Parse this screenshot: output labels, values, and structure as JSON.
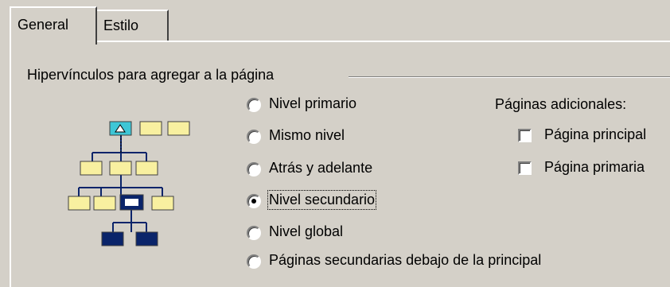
{
  "tabs": [
    {
      "label": "General"
    },
    {
      "label": "Estilo"
    }
  ],
  "group": {
    "label": "Hipervínculos para agregar a la página"
  },
  "options": [
    {
      "label": "Nivel primario",
      "selected": false
    },
    {
      "label": "Mismo nivel",
      "selected": false
    },
    {
      "label": "Atrás y adelante",
      "selected": false
    },
    {
      "label": "Nivel secundario",
      "selected": true
    },
    {
      "label": "Nivel global",
      "selected": false
    },
    {
      "label": "Páginas secundarias debajo de la principal",
      "selected": false
    }
  ],
  "additional": {
    "label": "Páginas adicionales:",
    "items": [
      {
        "label": "Página principal",
        "checked": false
      },
      {
        "label": "Página primaria",
        "checked": false
      }
    ]
  },
  "colors": {
    "box_fill": "#f8f0a0",
    "selected_fill": "#0a246a",
    "line": "#0a246a"
  }
}
